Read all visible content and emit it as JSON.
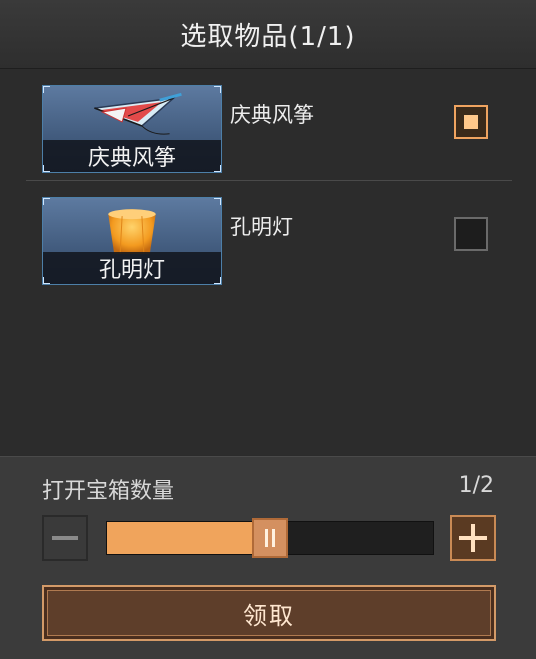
{
  "dialog": {
    "title": "选取物品(1/1)"
  },
  "items": [
    {
      "name": "庆典风筝",
      "thumb_label": "庆典风筝",
      "icon": "kite-icon",
      "selected": true
    },
    {
      "name": "孔明灯",
      "thumb_label": "孔明灯",
      "icon": "sky-lantern-icon",
      "selected": false
    }
  ],
  "quantity": {
    "label": "打开宝箱数量",
    "count_text": "1/2",
    "current": 1,
    "max": 2,
    "slider_fraction": 0.5,
    "minus_icon": "minus-icon",
    "plus_icon": "plus-icon"
  },
  "claim_button": {
    "label": "领取"
  },
  "colors": {
    "accent": "#f0a45c",
    "button_bg": "#5e3e2a",
    "button_border": "#d39a68"
  }
}
